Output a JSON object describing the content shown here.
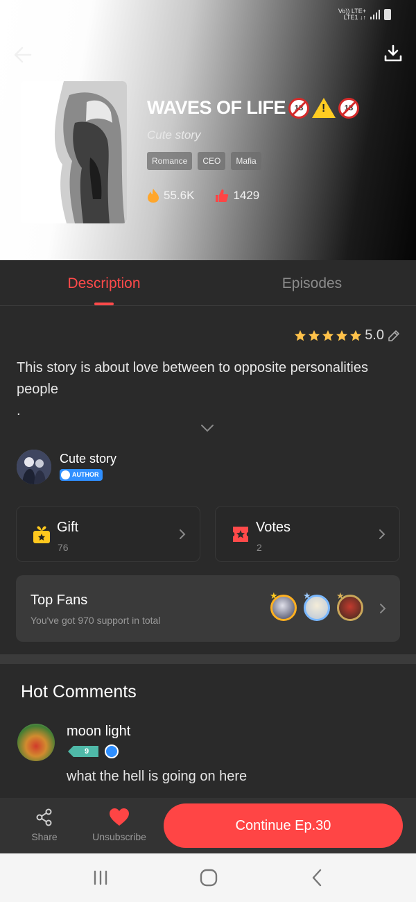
{
  "status_bar": {
    "network_top": "Vo)) LTE+",
    "network_bottom": "LTE1 ↓↑"
  },
  "book": {
    "title": "WAVES OF LIFE",
    "author_label": "Cute story",
    "tags": [
      "Romance",
      "CEO",
      "Mafia"
    ],
    "views": "55.6K",
    "likes": "1429",
    "badge_18": "18"
  },
  "tabs": [
    {
      "label": "Description",
      "active": true
    },
    {
      "label": "Episodes",
      "active": false
    }
  ],
  "rating": {
    "value": "5.0",
    "stars": 5
  },
  "description": "This story is about love between to opposite personalities people\n.",
  "author": {
    "name": "Cute story",
    "badge": "AUTHOR"
  },
  "cards": {
    "gift": {
      "label": "Gift",
      "count": "76"
    },
    "votes": {
      "label": "Votes",
      "count": "2"
    }
  },
  "top_fans": {
    "label": "Top Fans",
    "subtitle": "You've got 970 support in total"
  },
  "hot_comments": {
    "title": "Hot Comments",
    "items": [
      {
        "name": "moon light",
        "level": "9",
        "text": "what the hell is going on here"
      }
    ]
  },
  "bottom_bar": {
    "share": "Share",
    "unsubscribe": "Unsubscribe",
    "continue": "Continue Ep.30"
  },
  "colors": {
    "accent": "#ff4545",
    "tab_active": "#ff4a4a",
    "star": "#ffc24a",
    "author_badge": "#2f8fff"
  }
}
